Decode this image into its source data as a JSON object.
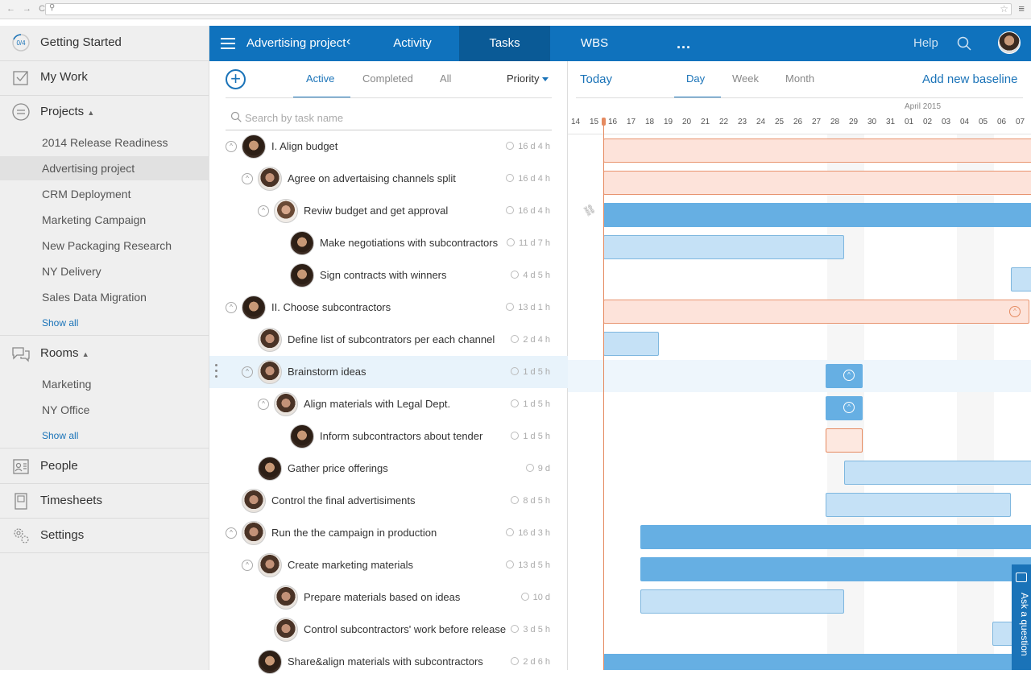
{
  "sidebar": {
    "getting_started": {
      "label": "Getting Started",
      "badge": "0/4"
    },
    "my_work": "My Work",
    "projects": {
      "label": "Projects",
      "items": [
        "2014 Release Readiness",
        "Advertising project",
        "CRM Deployment",
        "Marketing Campaign",
        "New Packaging Research",
        "NY Delivery",
        "Sales Data Migration"
      ],
      "active": "Advertising project",
      "show_all": "Show all"
    },
    "rooms": {
      "label": "Rooms",
      "items": [
        "Marketing",
        "NY Office"
      ],
      "show_all": "Show all"
    },
    "people": "People",
    "timesheets": "Timesheets",
    "settings": "Settings"
  },
  "header": {
    "project": "Advertising project",
    "tabs": [
      "Activity",
      "Tasks",
      "WBS"
    ],
    "active_tab": "Tasks",
    "more": "...",
    "help": "Help"
  },
  "tasks": {
    "filters": [
      "Active",
      "Completed",
      "All"
    ],
    "active_filter": "Active",
    "sort": "Priority",
    "search_placeholder": "Search by task name",
    "rows": [
      {
        "name": "I. Align budget",
        "duration": "16 d 4 h"
      },
      {
        "name": "Agree on advertaising channels split",
        "duration": "16 d 4 h"
      },
      {
        "name": "Reviw budget and get approval",
        "duration": "16 d 4 h"
      },
      {
        "name": "Make negotiations with subcontractors",
        "duration": "11 d 7 h"
      },
      {
        "name": "Sign contracts with winners",
        "duration": "4 d 5 h"
      },
      {
        "name": "II. Choose subcontractors",
        "duration": "13 d 1 h"
      },
      {
        "name": "Define list of subcontrators per each channel",
        "duration": "2 d 4 h"
      },
      {
        "name": "Brainstorm ideas",
        "duration": "1 d 5 h"
      },
      {
        "name": "Align materials with Legal Dept.",
        "duration": "1 d 5 h"
      },
      {
        "name": "Inform subcontractors about tender",
        "duration": "1 d 5 h"
      },
      {
        "name": "Gather price offerings",
        "duration": "9 d"
      },
      {
        "name": "Control the final advertisiments",
        "duration": "8 d 5 h"
      },
      {
        "name": "Run the the campaign in production",
        "duration": "16 d 3 h"
      },
      {
        "name": "Create marketing materials",
        "duration": "13 d 5 h"
      },
      {
        "name": "Prepare materials based on ideas",
        "duration": "10 d"
      },
      {
        "name": "Control subcontractors' work before release",
        "duration": "3 d 5 h"
      },
      {
        "name": "Share&align materials with subcontractors",
        "duration": "2 d 6 h"
      }
    ]
  },
  "gantt": {
    "today": "Today",
    "scales": [
      "Day",
      "Week",
      "Month"
    ],
    "active_scale": "Day",
    "baseline": "Add new baseline",
    "month": "April 2015",
    "days": [
      "14",
      "15",
      "16",
      "17",
      "18",
      "19",
      "20",
      "21",
      "22",
      "23",
      "24",
      "25",
      "26",
      "27",
      "28",
      "29",
      "30",
      "31",
      "01",
      "02",
      "03",
      "04",
      "05",
      "06",
      "07"
    ]
  },
  "ask_question": "Ask a question",
  "colors": {
    "brand": "#0f72bd",
    "summary_orange": "#e58a60",
    "summary_blue": "#66afe3",
    "task_blue": "#c5e1f6"
  }
}
